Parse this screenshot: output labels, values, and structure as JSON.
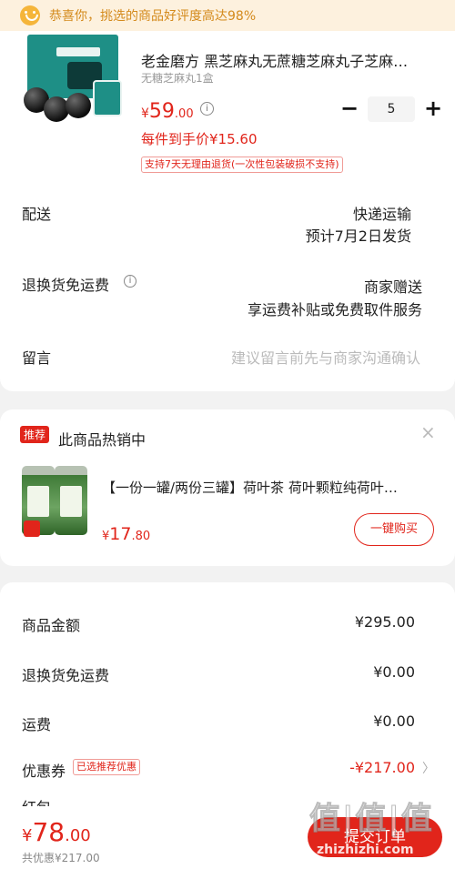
{
  "banner": {
    "icon": "smile-icon",
    "text": "恭喜你，挑选的商品好评度高达98%"
  },
  "product": {
    "title": "老金磨方 黑芝麻丸无蔗糖芝麻丸子芝麻…",
    "spec": "无糖芝麻丸1盒",
    "price_currency": "¥",
    "price_int": "59",
    "price_dec": ".00",
    "quantity": "5",
    "minus": "−",
    "plus": "+",
    "unit_price": "每件到手价¥15.60",
    "return_policy": "支持7天无理由退货(一次性包装破损不支持)"
  },
  "delivery": {
    "label": "配送",
    "method": "快递运输",
    "eta": "预计7月2日发货"
  },
  "free_return": {
    "label": "退换货免运费",
    "line1": "商家赠送",
    "line2": "享运费补贴或免费取件服务"
  },
  "message": {
    "label": "留言",
    "placeholder": "建议留言前先与商家沟通确认"
  },
  "recommend": {
    "badge": "推荐",
    "title": "此商品热销中",
    "close": "×",
    "item_title": "【一份一罐/两份三罐】荷叶茶 荷叶颗粒纯荷叶…",
    "price_currency": "¥",
    "price_int": "17",
    "price_dec": ".80",
    "buy_label": "一键购买"
  },
  "summary": {
    "goods_amount_label": "商品金额",
    "goods_amount": "¥295.00",
    "return_label": "退换货免运费",
    "return_value": "¥0.00",
    "shipping_label": "运费",
    "shipping_value": "¥0.00",
    "coupon_label": "优惠券",
    "coupon_tag": "已选推荐优惠",
    "coupon_value": "-¥217.00",
    "partial_label": "红包"
  },
  "footer": {
    "total_currency": "¥",
    "total_int": "78",
    "total_dec": ".00",
    "discount": "共优惠¥217.00",
    "submit_label": "提交订单",
    "watermark_logo": "值|值|值",
    "watermark_url": "zhizhizhi.com"
  },
  "colors": {
    "accent": "#e1251b",
    "banner_bg": "#fdf1de",
    "banner_text": "#d48a1c"
  }
}
